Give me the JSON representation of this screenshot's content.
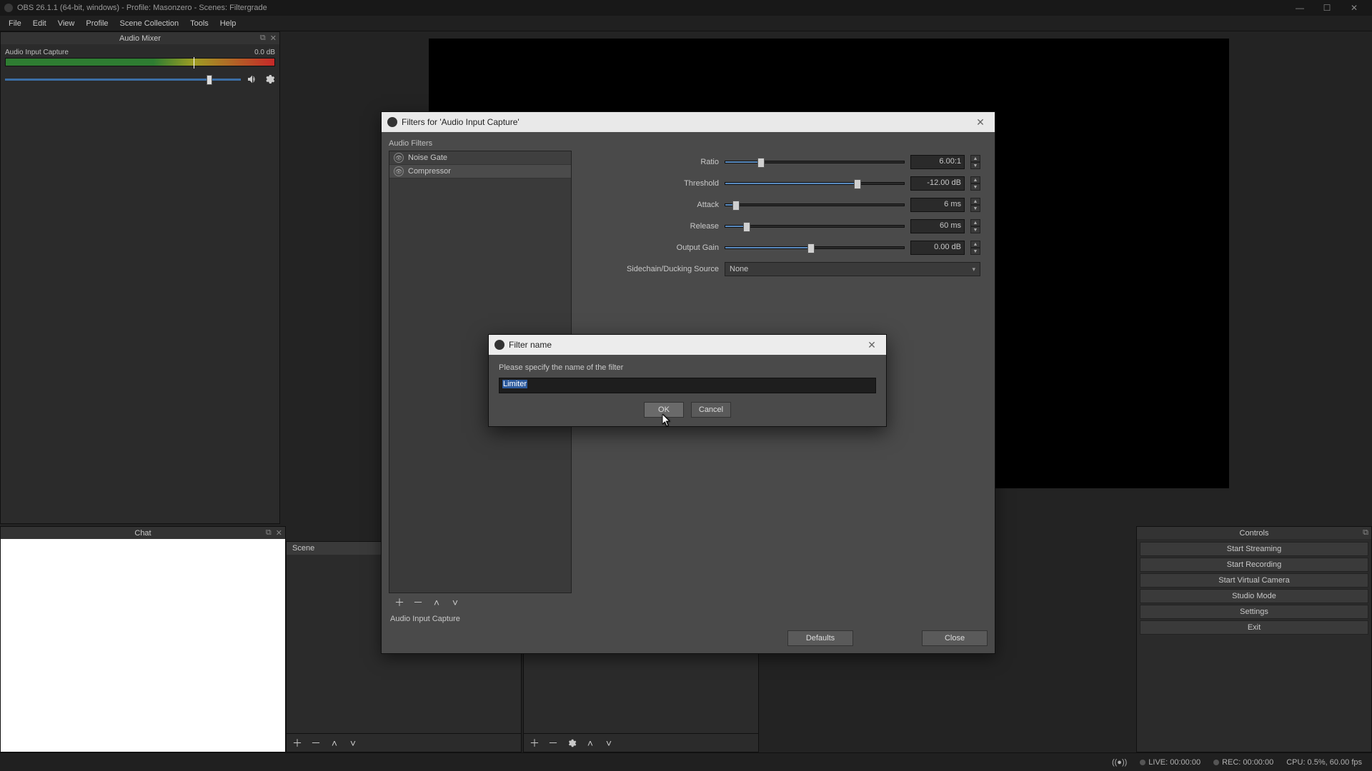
{
  "title": "OBS 26.1.1 (64-bit, windows) - Profile: Masonzero - Scenes: Filtergrade",
  "menu": [
    "File",
    "Edit",
    "View",
    "Profile",
    "Scene Collection",
    "Tools",
    "Help"
  ],
  "audioMixer": {
    "title": "Audio Mixer",
    "source_name": "Audio Input Capture",
    "level_db": "0.0 dB"
  },
  "chat": {
    "title": "Chat"
  },
  "scene": {
    "selected": "Scene"
  },
  "controls": {
    "title": "Controls",
    "buttons": [
      "Start Streaming",
      "Start Recording",
      "Start Virtual Camera",
      "Studio Mode",
      "Settings",
      "Exit"
    ]
  },
  "filtersDialog": {
    "title": "Filters for 'Audio Input Capture'",
    "section": "Audio Filters",
    "list": [
      {
        "name": "Noise Gate"
      },
      {
        "name": "Compressor"
      }
    ],
    "props": {
      "ratio": {
        "label": "Ratio",
        "value": "6.00:1",
        "fill_pct": 18,
        "thumb_pct": 18
      },
      "threshold": {
        "label": "Threshold",
        "value": "-12.00 dB",
        "fill_pct": 72,
        "thumb_pct": 72
      },
      "attack": {
        "label": "Attack",
        "value": "6 ms",
        "fill_pct": 4,
        "thumb_pct": 4
      },
      "release": {
        "label": "Release",
        "value": "60 ms",
        "fill_pct": 10,
        "thumb_pct": 10
      },
      "output_gain": {
        "label": "Output Gain",
        "value": "0.00 dB",
        "fill_pct": 46,
        "thumb_pct": 46
      },
      "sidechain": {
        "label": "Sidechain/Ducking Source",
        "value": "None"
      }
    },
    "defaults": "Defaults",
    "close": "Close",
    "bottom_source": "Audio Input Capture"
  },
  "nameDialog": {
    "title": "Filter name",
    "prompt": "Please specify the name of the filter",
    "value": "Limiter",
    "ok": "OK",
    "cancel": "Cancel"
  },
  "status": {
    "live": "LIVE: 00:00:00",
    "rec": "REC: 00:00:00",
    "cpu": "CPU: 0.5%, 60.00 fps"
  }
}
